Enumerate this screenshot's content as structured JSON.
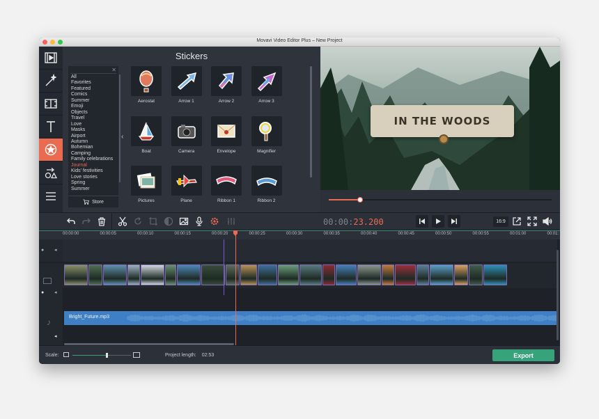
{
  "window": {
    "title": "Movavi Video Editor Plus – New Project"
  },
  "sidebar": {
    "tools": [
      {
        "icon": "film-import-icon"
      },
      {
        "icon": "magic-wand-icon"
      },
      {
        "icon": "transitions-icon"
      },
      {
        "icon": "titles-icon"
      },
      {
        "icon": "stickers-icon",
        "active": true
      },
      {
        "icon": "callouts-icon"
      },
      {
        "icon": "more-menu-icon"
      }
    ]
  },
  "stickers": {
    "title": "Stickers",
    "categories": [
      "All",
      "Favorites",
      "Featured",
      "Comics",
      "Summer",
      "Emoji",
      "Objects",
      "Travel",
      "Love",
      "Masks",
      "Airport",
      "Autumn",
      "Bohemian",
      "Camping",
      "Family celebrations",
      "Journal",
      "Kids' festivities",
      "Love stories",
      "Spring",
      "Summer"
    ],
    "selected_category": "Journal",
    "store_label": "Store",
    "items": [
      {
        "label": "Aerostat"
      },
      {
        "label": "Arrow 1"
      },
      {
        "label": "Arrow 2"
      },
      {
        "label": "Arrow 3"
      },
      {
        "label": "Boat"
      },
      {
        "label": "Camera"
      },
      {
        "label": "Envelope"
      },
      {
        "label": "Magnifier"
      },
      {
        "label": "Pictures"
      },
      {
        "label": "Plane"
      },
      {
        "label": "Ribbon 1"
      },
      {
        "label": "Ribbon 2"
      }
    ]
  },
  "preview": {
    "caption": "IN THE WOODS",
    "progress_fraction": 0.14
  },
  "playback": {
    "timecode_dim": "00:00:",
    "timecode_hl": "23.200",
    "aspect_ratio": "16:9"
  },
  "timeline": {
    "ticks": [
      "00:00:00",
      "00:00:05",
      "00:00:10",
      "00:00:15",
      "00:00:20",
      "00:00:25",
      "00:00:30",
      "00:00:35",
      "00:00:40",
      "00:00:45",
      "00:00:50",
      "00:00:55",
      "00:01:00",
      "00:01:"
    ],
    "audio_clip": "Bright_Future.mp3",
    "clip_colors": [
      "#8a8f6a",
      "#4f6e52",
      "#5f8fae",
      "#9bb0c0",
      "#cfd6dc",
      "#6a8f6f",
      "#4c87b8",
      "#3a4c3a",
      "#5f6b5a",
      "#b89157",
      "#3d6f9a",
      "#6a9c7a",
      "#587a7d",
      "#8b2a35",
      "#447fb8",
      "#8b958d",
      "#c07a3c",
      "#9a2f3d",
      "#5b7f97",
      "#5a9fc8",
      "#d8a060",
      "#405c48",
      "#2f8fb8"
    ]
  },
  "bottom": {
    "scale_label": "Scale:",
    "scale_fraction": 0.58,
    "project_length_label": "Project length:",
    "project_length_value": "02:53",
    "export_label": "Export"
  },
  "colors": {
    "accent": "#ea6b4f",
    "export": "#36a37b",
    "audio": "#3f7fc5"
  }
}
